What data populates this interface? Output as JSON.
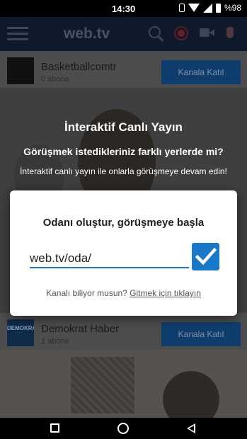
{
  "status_bar": {
    "time": "14:30",
    "battery": "%98"
  },
  "header": {
    "logo": "web.tv"
  },
  "channels": [
    {
      "thumb": "",
      "name": "Basketballcomtr",
      "subscribers": "0 abone",
      "join_label": "Kanala Katıl"
    },
    {
      "thumb": "DEMOKRAT",
      "name": "Demokrat Haber",
      "subscribers": "1 abone",
      "join_label": "Kanala Katıl"
    }
  ],
  "overlay": {
    "title": "İnteraktif Canlı Yayın",
    "question": "Görüşmek istedikleriniz farklı yerlerde mi?",
    "description": "İnteraktif canlı yayın ile onlarla görüşmeye devam edin!"
  },
  "dialog": {
    "title": "Odanı oluştur, görüşmeye başla",
    "input_value": "web.tv/oda/",
    "footer_text": "Kanalı biliyor musun? ",
    "footer_link": "Gitmek için tıklayın"
  },
  "colors": {
    "accent": "#1a78c8",
    "header_bg": "#0e1a2b"
  }
}
